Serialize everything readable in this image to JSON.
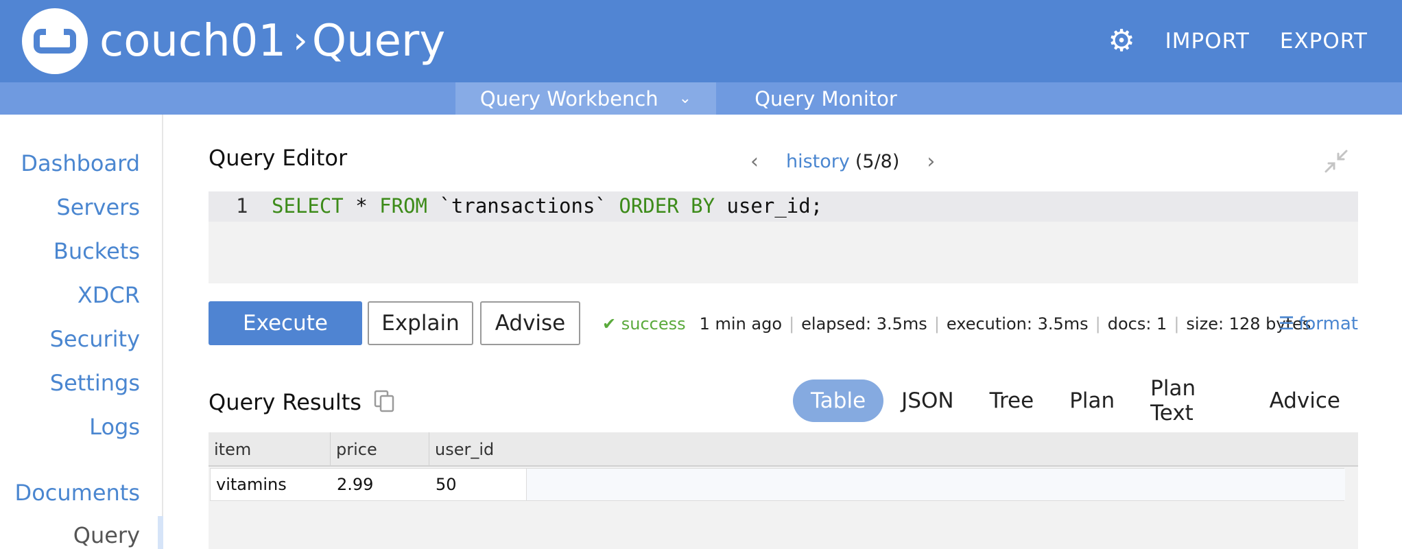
{
  "header": {
    "cluster": "couch01",
    "separator": "›",
    "page": "Query",
    "import_label": "IMPORT",
    "export_label": "EXPORT",
    "brand_color": "#5185d3"
  },
  "subnav": {
    "workbench_label": "Query Workbench",
    "monitor_label": "Query Monitor"
  },
  "sidebar": {
    "items": [
      {
        "label": "Dashboard"
      },
      {
        "label": "Servers"
      },
      {
        "label": "Buckets"
      },
      {
        "label": "XDCR"
      },
      {
        "label": "Security"
      },
      {
        "label": "Settings"
      },
      {
        "label": "Logs"
      },
      {
        "label": "Documents"
      },
      {
        "label": "Query"
      }
    ]
  },
  "editor": {
    "title": "Query Editor",
    "history_label": "history",
    "history_count": "(5/8)",
    "line_number": "1",
    "code": {
      "kw1": "SELECT",
      "t1": " * ",
      "kw2": "FROM",
      "t2": " `transactions` ",
      "kw3": "ORDER BY",
      "t3": " user_id;"
    }
  },
  "actions": {
    "execute_label": "Execute",
    "explain_label": "Explain",
    "advise_label": "Advise"
  },
  "status": {
    "state": "success",
    "time": "1 min ago",
    "elapsed": "elapsed: 3.5ms",
    "execution": "execution: 3.5ms",
    "docs": "docs: 1",
    "size": "size: 128 bytes",
    "format_label": "format",
    "success_color": "#5aaa3c"
  },
  "results": {
    "title": "Query Results",
    "tabs": [
      "Table",
      "JSON",
      "Tree",
      "Plan",
      "Plan Text",
      "Advice"
    ],
    "active_tab": "Table",
    "columns": [
      "item",
      "price",
      "user_id"
    ],
    "rows": [
      [
        "vitamins",
        "2.99",
        "50"
      ]
    ]
  }
}
